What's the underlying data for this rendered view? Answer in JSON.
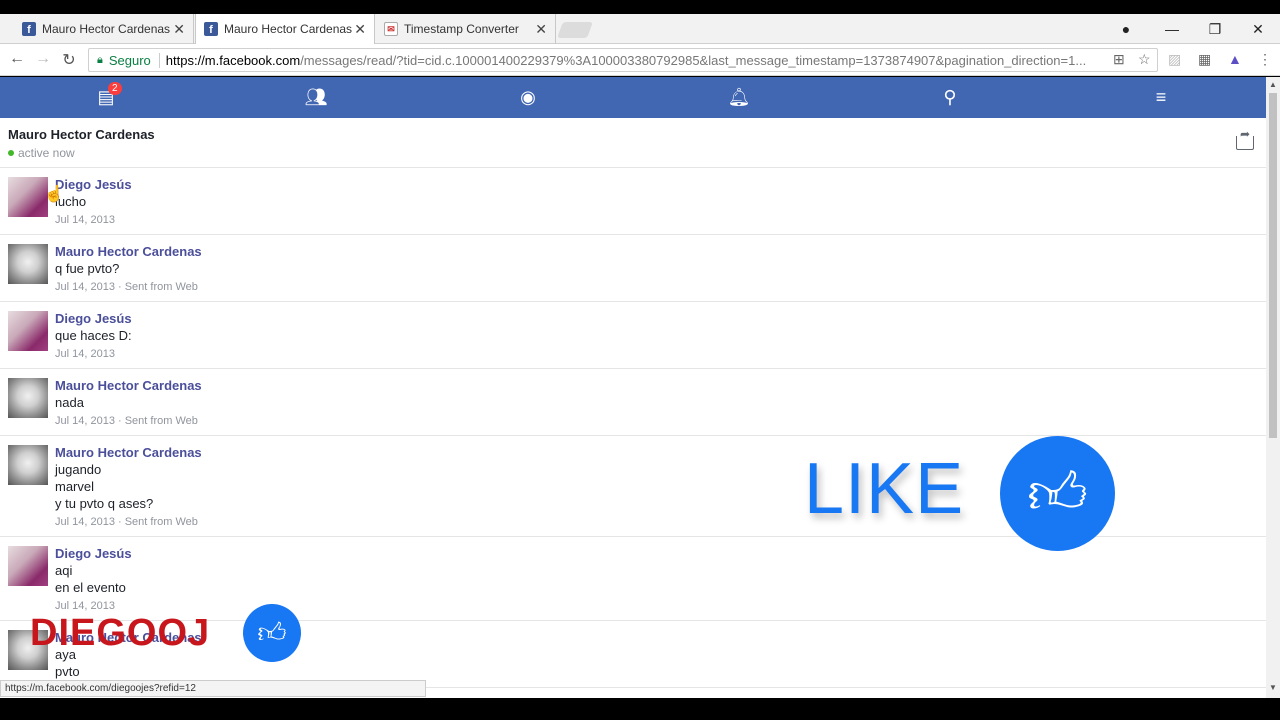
{
  "browser": {
    "tabs": [
      {
        "title": "Mauro Hector Cardenas",
        "favicon": "facebook-icon"
      },
      {
        "title": "Mauro Hector Cardenas",
        "favicon": "facebook-icon"
      },
      {
        "title": "Timestamp Converter",
        "favicon": "mail-icon"
      }
    ],
    "security_label": "Seguro",
    "url_host": "https://m.facebook.com",
    "url_path": "/messages/read/?tid=cid.c.100001400229379%3A100003380792985&last_message_timestamp=1373874907&pagination_direction=1...",
    "status_url": "https://m.facebook.com/diegoojes?refid=12"
  },
  "fbnav": {
    "badge_count": "2",
    "accent": "#4267b2"
  },
  "conversation": {
    "title": "Mauro Hector Cardenas",
    "status": "active now"
  },
  "messages": [
    {
      "sender": "Diego Jesús",
      "avatar": "diego",
      "lines": [
        "lucho"
      ],
      "meta": "Jul 14, 2013"
    },
    {
      "sender": "Mauro Hector Cardenas",
      "avatar": "mauro",
      "lines": [
        "q fue pvto?"
      ],
      "meta": "Jul 14, 2013 · Sent from Web"
    },
    {
      "sender": "Diego Jesús",
      "avatar": "diego",
      "lines": [
        "que haces D:"
      ],
      "meta": "Jul 14, 2013"
    },
    {
      "sender": "Mauro Hector Cardenas",
      "avatar": "mauro",
      "lines": [
        "nada"
      ],
      "meta": "Jul 14, 2013 · Sent from Web"
    },
    {
      "sender": "Mauro Hector Cardenas",
      "avatar": "mauro",
      "lines": [
        "jugando",
        "marvel",
        "y tu pvto q ases?"
      ],
      "meta": "Jul 14, 2013 · Sent from Web"
    },
    {
      "sender": "Diego Jesús",
      "avatar": "diego",
      "lines": [
        "aqi",
        "en el evento"
      ],
      "meta": "Jul 14, 2013"
    },
    {
      "sender": "Mauro Hector Cardenas",
      "avatar": "mauro",
      "lines": [
        "aya",
        "pvto"
      ],
      "meta": ""
    }
  ],
  "overlay": {
    "like_text": "LIKE",
    "channel_text": "DIEGOOJ"
  }
}
